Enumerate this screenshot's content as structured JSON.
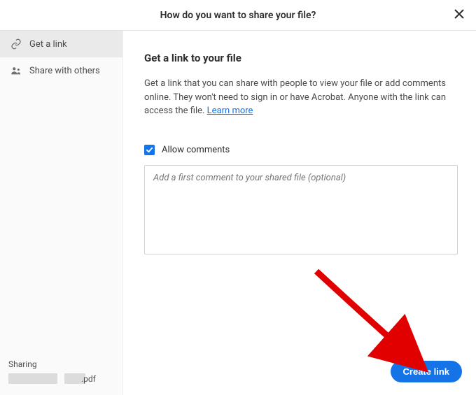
{
  "header": {
    "title": "How do you want to share your file?"
  },
  "sidebar": {
    "items": [
      {
        "label": "Get a link"
      },
      {
        "label": "Share with others"
      }
    ],
    "footer": {
      "sharing_label": "Sharing",
      "file_ext": ".pdf"
    }
  },
  "main": {
    "title": "Get a link to your file",
    "description": "Get a link that you can share with people to view your file or add comments online. They won't need to sign in or have Acrobat. Anyone with the link can access the file. ",
    "learn_more": "Learn more",
    "allow_comments_label": "Allow comments",
    "comment_placeholder": "Add a first comment to your shared file (optional)",
    "create_button": "Create link"
  }
}
